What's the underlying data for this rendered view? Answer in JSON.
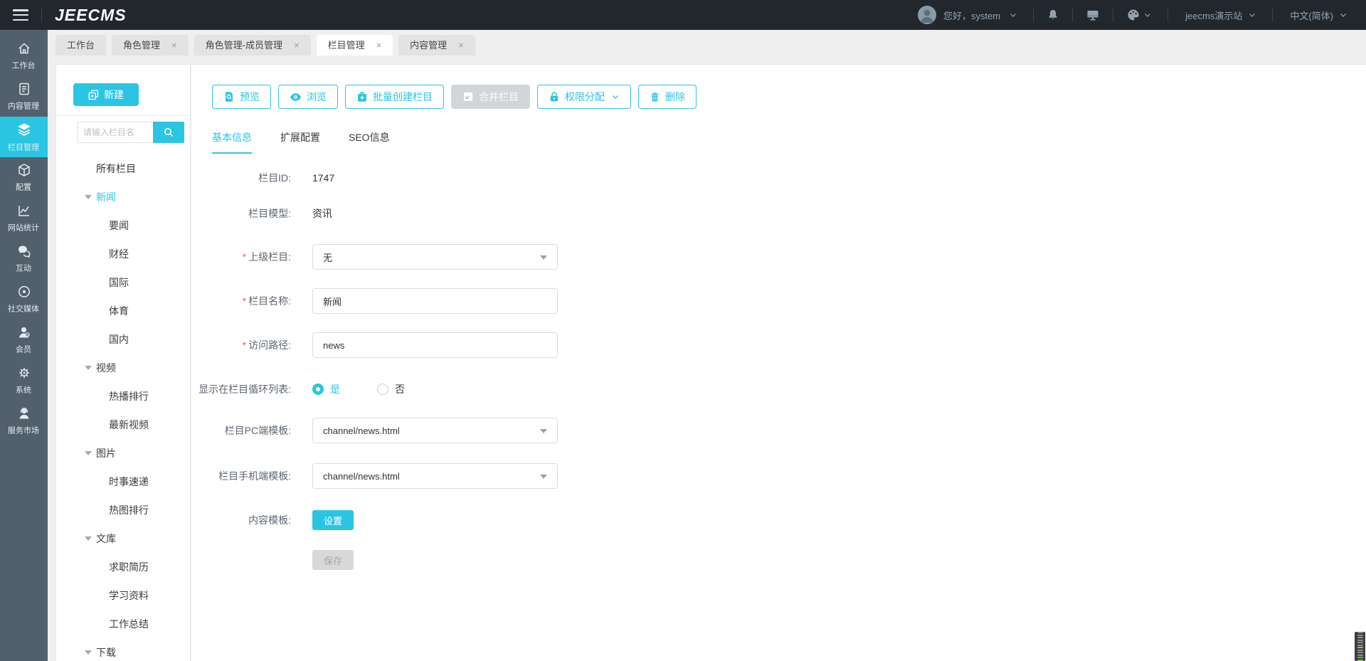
{
  "header": {
    "logo": "JEECMS",
    "greeting": "您好，system",
    "site_name": "jeecms演示站",
    "language": "中文(简体)"
  },
  "tabs": [
    {
      "label": "工作台"
    },
    {
      "label": "角色管理"
    },
    {
      "label": "角色管理-成员管理"
    },
    {
      "label": "栏目管理"
    },
    {
      "label": "内容管理"
    }
  ],
  "sidebar": {
    "items": [
      {
        "label": "工作台"
      },
      {
        "label": "内容管理"
      },
      {
        "label": "栏目管理"
      },
      {
        "label": "配置"
      },
      {
        "label": "网站统计"
      },
      {
        "label": "互动"
      },
      {
        "label": "社交媒体"
      },
      {
        "label": "会员"
      },
      {
        "label": "系统"
      },
      {
        "label": "服务市场"
      }
    ]
  },
  "tree_panel": {
    "new_button": "新建",
    "search_placeholder": "请输入栏目名",
    "root_label": "所有栏目",
    "nodes": [
      {
        "label": "新闻"
      },
      {
        "label": "要闻"
      },
      {
        "label": "财经"
      },
      {
        "label": "国际"
      },
      {
        "label": "体育"
      },
      {
        "label": "国内"
      },
      {
        "label": "视频"
      },
      {
        "label": "热播排行"
      },
      {
        "label": "最新视频"
      },
      {
        "label": "图片"
      },
      {
        "label": "时事速递"
      },
      {
        "label": "热图排行"
      },
      {
        "label": "文库"
      },
      {
        "label": "求职简历"
      },
      {
        "label": "学习资料"
      },
      {
        "label": "工作总结"
      },
      {
        "label": "下载"
      }
    ]
  },
  "toolbar": {
    "buttons": [
      {
        "label": "预览"
      },
      {
        "label": "浏览"
      },
      {
        "label": "批量创建栏目"
      },
      {
        "label": "合并栏目"
      },
      {
        "label": "权限分配"
      },
      {
        "label": "删除"
      }
    ]
  },
  "form_tabs": [
    "基本信息",
    "扩展配置",
    "SEO信息"
  ],
  "form": {
    "required_mark": "*",
    "id_label": "栏目ID:",
    "id_value": "1747",
    "model_label": "栏目模型:",
    "model_value": "资讯",
    "parent_label": "上级栏目:",
    "parent_value": "无",
    "name_label": "栏目名称:",
    "name_value": "新闻",
    "path_label": "访问路径:",
    "path_value": "news",
    "loop_label": "显示在栏目循环列表:",
    "loop_yes": "是",
    "loop_no": "否",
    "pc_tpl_label": "栏目PC端模板:",
    "pc_tpl_value": "channel/news.html",
    "mobile_tpl_label": "栏目手机端模板:",
    "mobile_tpl_value": "channel/news.html",
    "content_tpl_label": "内容模板:",
    "set_button": "设置",
    "save_button": "保存"
  },
  "colors": {
    "accent": "#2bc5e4",
    "required": "#f25b5b",
    "topbar_bg": "#22272e",
    "sidenav_bg": "#51606c"
  }
}
